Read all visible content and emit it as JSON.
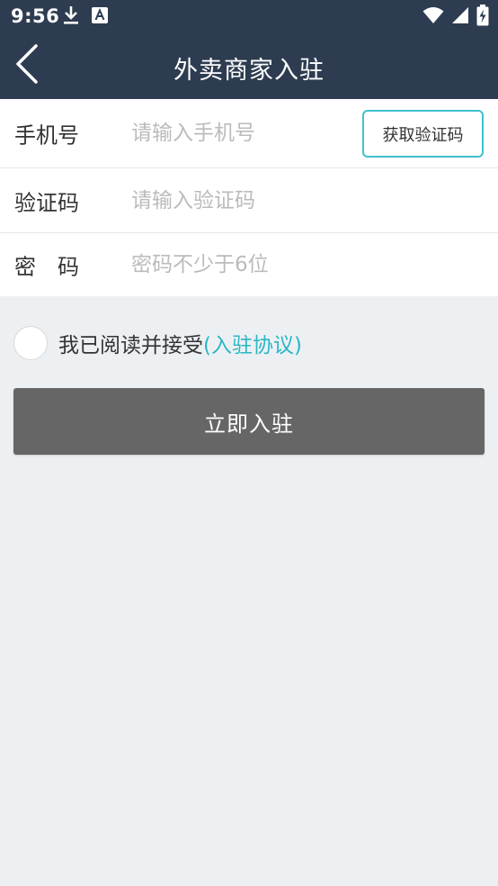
{
  "status_bar": {
    "time": "9:56"
  },
  "header": {
    "title": "外卖商家入驻"
  },
  "form": {
    "phone": {
      "label": "手机号",
      "placeholder": "请输入手机号",
      "get_code_label": "获取验证码"
    },
    "code": {
      "label": "验证码",
      "placeholder": "请输入验证码"
    },
    "password": {
      "label": "密　码",
      "placeholder": "密码不少于6位"
    }
  },
  "agreement": {
    "text": "我已阅读并接受",
    "link_text": "(入驻协议)"
  },
  "submit": {
    "label": "立即入驻"
  },
  "colors": {
    "header_bg": "#2d3c50",
    "page_bg": "#edf0f3",
    "accent": "#29b8c4",
    "button_bg": "#666666"
  },
  "icons": {
    "status_left": [
      "download-icon",
      "font-a-icon"
    ],
    "status_right": [
      "wifi-icon",
      "cell-signal-icon",
      "battery-charging-icon"
    ],
    "nav": "back-arrow-icon"
  }
}
